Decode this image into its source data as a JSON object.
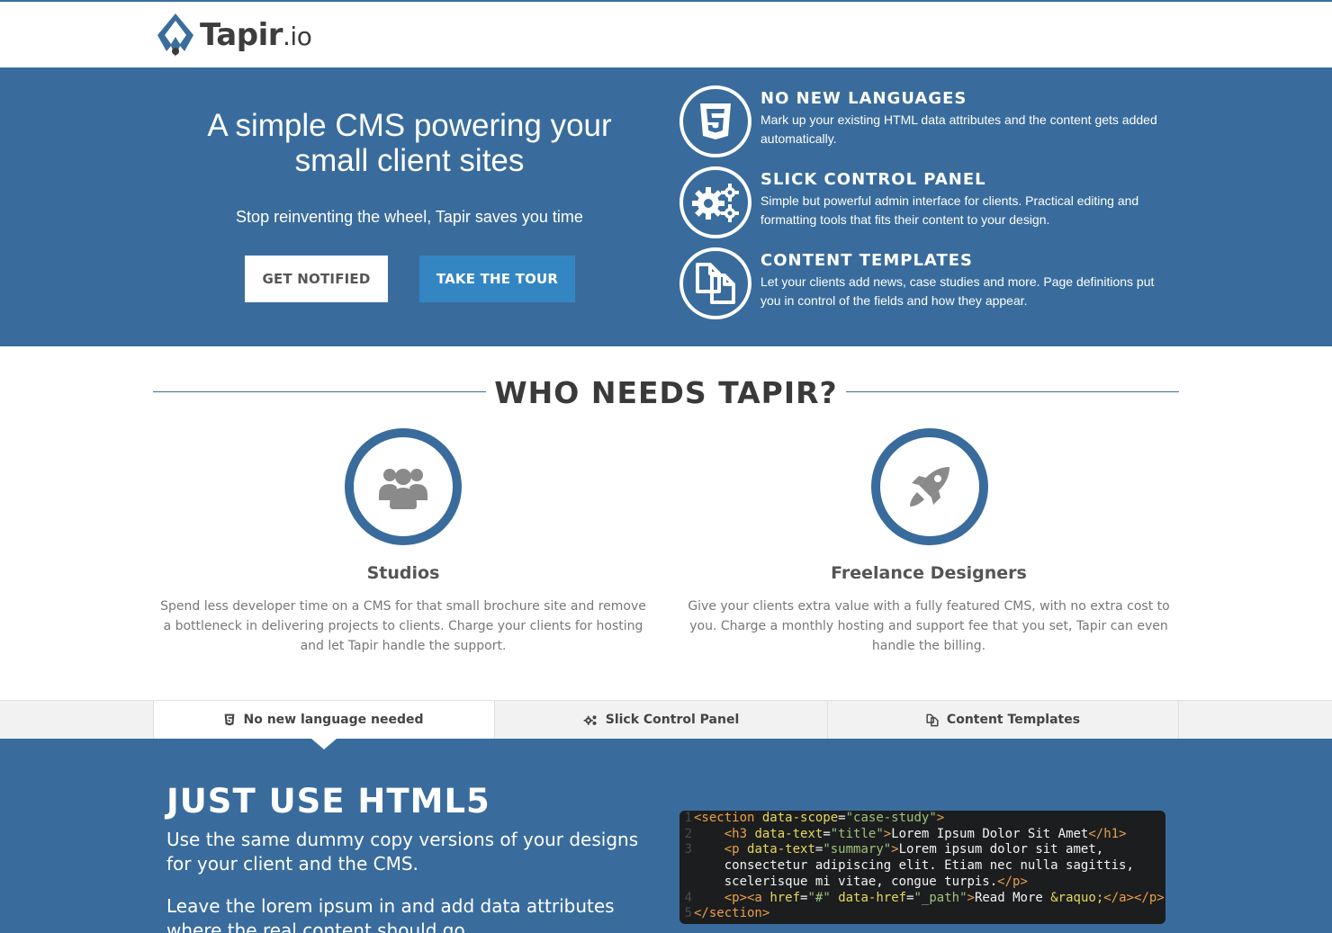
{
  "header": {
    "logo_name": "Tapir",
    "logo_tld": ".io"
  },
  "hero": {
    "title": "A simple CMS powering your small client sites",
    "subtitle": "Stop reinventing the wheel, Tapir saves you time",
    "notify_label": "GET NOTIFIED",
    "tour_label": "TAKE THE TOUR",
    "features": [
      {
        "icon": "html5-icon",
        "title": "NO NEW LANGUAGES",
        "text": "Mark up your existing HTML data attributes and the content gets added automatically."
      },
      {
        "icon": "gears-icon",
        "title": "SLICK CONTROL PANEL",
        "text": "Simple but powerful admin interface for clients. Practical editing and formatting tools that fits their content to your design."
      },
      {
        "icon": "copy-icon",
        "title": "CONTENT TEMPLATES",
        "text": "Let your clients add news, case studies and more. Page definitions put you in control of the fields and how they appear."
      }
    ]
  },
  "who": {
    "title": "WHO NEEDS TAPIR?",
    "audiences": [
      {
        "icon": "group-icon",
        "title": "Studios",
        "text": "Spend less developer time on a CMS for that small brochure site and remove a bottleneck in delivering projects to clients. Charge your clients for hosting and let Tapir handle the support."
      },
      {
        "icon": "rocket-icon",
        "title": "Freelance Designers",
        "text": "Give your clients extra value with a fully featured CMS, with no extra cost to you. Charge a monthly hosting and support fee that you set, Tapir can even handle the billing."
      }
    ]
  },
  "tabs": [
    {
      "icon": "html5-icon",
      "label": "No new language needed",
      "active": true
    },
    {
      "icon": "gears-icon",
      "label": "Slick Control Panel",
      "active": false
    },
    {
      "icon": "copy-icon",
      "label": "Content Templates",
      "active": false
    }
  ],
  "lower": {
    "title": "JUST USE HTML5",
    "para1": "Use the same dummy copy versions of your designs for your client and the CMS.",
    "para2": "Leave the lorem ipsum in and add data attributes where the real content should go."
  },
  "code": {
    "line_numbers": [
      "1",
      "2",
      "3",
      "",
      "",
      "4",
      "5"
    ],
    "l1_tag": "<section",
    "l1_attr": "data-scope",
    "l1_eq": "=",
    "l1_val": "\"case-study\"",
    "l1_close": ">",
    "l2_indent": "    ",
    "l2_tag": "<h3",
    "l2_attr": "data-text",
    "l2_eq": "=",
    "l2_val": "\"title\"",
    "l2_gt": ">",
    "l2_text": "Lorem Ipsum Dolor Sit Amet",
    "l2_end": "</h1>",
    "l3_tag": "<p",
    "l3_attr": "data-text",
    "l3_eq": "=",
    "l3_val": "\"summary\"",
    "l3_gt": ">",
    "l3_text": "Lorem ipsum dolor sit amet,",
    "l3b_text": "consectetur adipiscing elit. Etiam nec nulla sagittis,",
    "l3c_text": "scelerisque mi vitae, congue turpis.",
    "l3c_end": "</p>",
    "l4_tag": "<p><a",
    "l4_attr1": "href",
    "l4_eq1": "=",
    "l4_val1": "\"#\"",
    "l4_attr2": "data-href",
    "l4_eq2": "=",
    "l4_val2": "\"_path\"",
    "l4_gt": ">",
    "l4_text": "Read More",
    "l4_entity": "&raquo;",
    "l4_end": "</a></p>",
    "l5_tag": "</section>"
  },
  "colors": {
    "brand_blue": "#396c9c",
    "tour_button": "#3486c2"
  }
}
